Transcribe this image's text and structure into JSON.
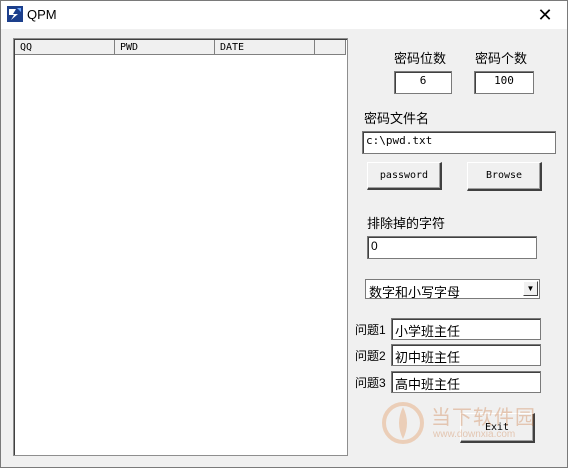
{
  "window": {
    "title": "QPM",
    "close_glyph": "✕"
  },
  "table": {
    "columns": [
      "QQ",
      "PWD",
      "DATE",
      ""
    ],
    "rows": []
  },
  "password_length": {
    "label": "密码位数",
    "value": "6"
  },
  "password_count": {
    "label": "密码个数",
    "value": "100"
  },
  "password_file": {
    "label": "密码文件名",
    "value": "c:\\pwd.txt"
  },
  "buttons": {
    "password": "password",
    "browse": "Browse",
    "exit": "Exit"
  },
  "exclude": {
    "label": "排除掉的字符",
    "value": "0"
  },
  "charset": {
    "selected": "数字和小写字母",
    "arrow": "▼"
  },
  "questions": [
    {
      "label": "问题1",
      "value": "小学班主任"
    },
    {
      "label": "问题2",
      "value": "初中班主任"
    },
    {
      "label": "问题3",
      "value": "高中班主任"
    }
  ],
  "watermark": {
    "brand": "当下软件园",
    "url": "www.downxia.com"
  }
}
